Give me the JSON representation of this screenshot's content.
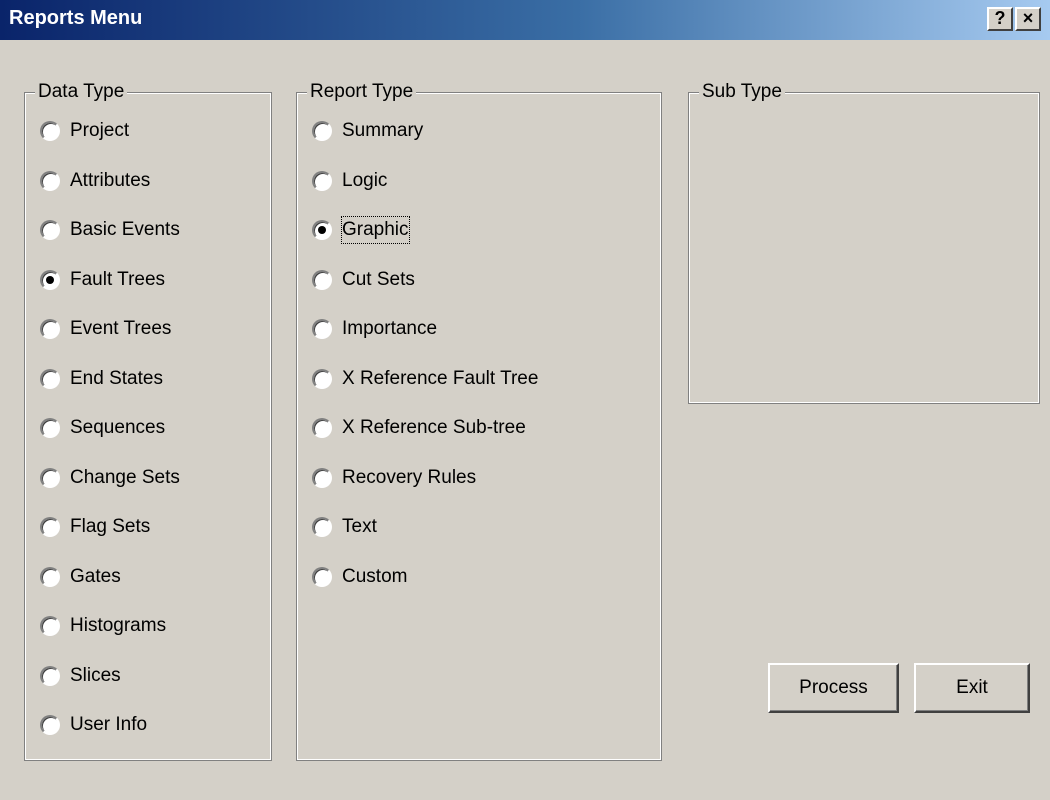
{
  "window": {
    "title": "Reports Menu",
    "help_icon": "?",
    "close_icon": "×"
  },
  "data_type": {
    "legend": "Data Type",
    "selected": "Fault Trees",
    "options": [
      "Project",
      "Attributes",
      "Basic Events",
      "Fault Trees",
      "Event Trees",
      "End States",
      "Sequences",
      "Change Sets",
      "Flag Sets",
      "Gates",
      "Histograms",
      "Slices",
      "User Info"
    ]
  },
  "report_type": {
    "legend": "Report Type",
    "selected": "Graphic",
    "options": [
      "Summary",
      "Logic",
      "Graphic",
      "Cut Sets",
      "Importance",
      "X Reference Fault Tree",
      "X Reference Sub-tree",
      "Recovery Rules",
      "Text",
      "Custom"
    ]
  },
  "sub_type": {
    "legend": "Sub Type"
  },
  "buttons": {
    "process": "Process",
    "exit": "Exit"
  },
  "colors": {
    "face": "#d4d0c8",
    "title_start": "#0a246a",
    "title_end": "#a6caf0"
  }
}
